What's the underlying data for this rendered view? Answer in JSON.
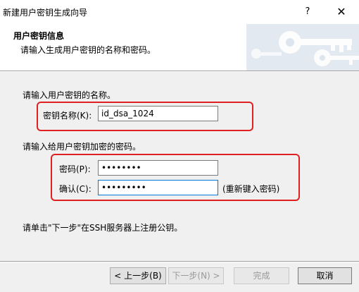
{
  "window": {
    "title": "新建用户密钥生成向导",
    "help_label": "?",
    "close_label": "✕"
  },
  "header": {
    "title": "用户密钥信息",
    "subtitle": "请输入生成用户密钥的名称和密码。"
  },
  "name_section": {
    "prompt": "请输入用户密钥的名称。",
    "key_name_label": "密钥名称(K):",
    "key_name_value": "id_dsa_1024"
  },
  "password_section": {
    "prompt": "请输入给用户密钥加密的密码。",
    "password_label": "密码(P):",
    "password_value": "••••••••",
    "confirm_label": "确认(C):",
    "confirm_value": "•••••••••",
    "reenter_hint": "(重新键入密码)"
  },
  "instruction": "请单击\"下一步\"在SSH服务器上注册公钥。",
  "buttons": {
    "back": "< 上一步(B)",
    "next": "下一步(N) >",
    "finish": "完成",
    "cancel": "取消"
  },
  "colors": {
    "highlight": "#e02020",
    "focus_border": "#0078d7"
  }
}
